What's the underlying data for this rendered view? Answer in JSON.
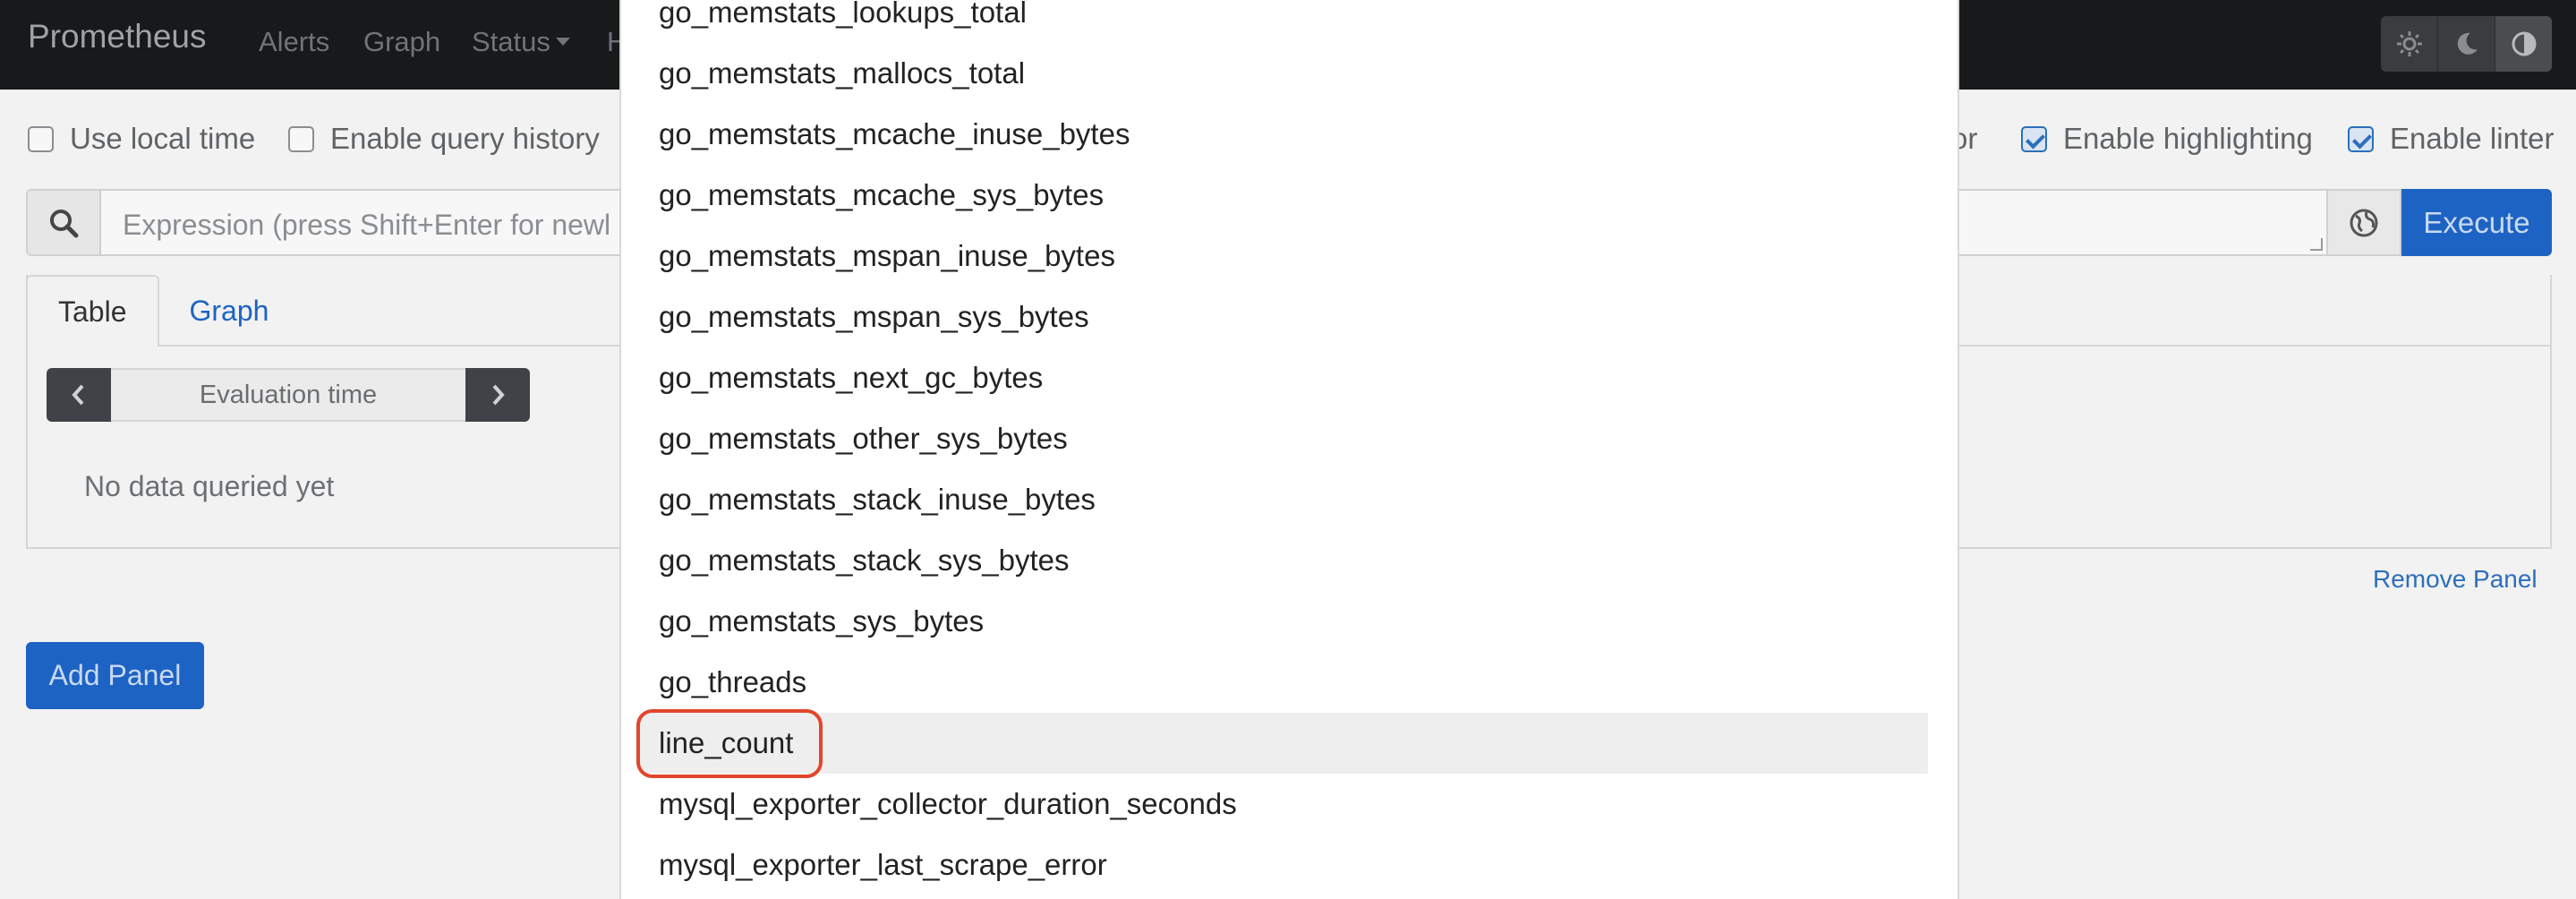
{
  "navbar": {
    "brand": "Prometheus",
    "links": [
      "Alerts",
      "Graph",
      "Status",
      "H"
    ],
    "theme_icons": [
      "sun-icon",
      "moon-icon",
      "half-circle-icon"
    ]
  },
  "options": {
    "use_local_time": "Use local time",
    "enable_query_history": "Enable query history",
    "partial_autocomplete_suffix": "or",
    "enable_highlighting": "Enable highlighting",
    "enable_linter": "Enable linter"
  },
  "expression": {
    "placeholder": "Expression (press Shift+Enter for newl",
    "execute_label": "Execute"
  },
  "panel": {
    "tabs": [
      "Table",
      "Graph"
    ],
    "evaluation_time_placeholder": "Evaluation time",
    "empty_message": "No data queried yet",
    "remove_label": "Remove Panel"
  },
  "add_panel_label": "Add Panel",
  "autocomplete": {
    "items": [
      "go_memstats_lookups_total",
      "go_memstats_mallocs_total",
      "go_memstats_mcache_inuse_bytes",
      "go_memstats_mcache_sys_bytes",
      "go_memstats_mspan_inuse_bytes",
      "go_memstats_mspan_sys_bytes",
      "go_memstats_next_gc_bytes",
      "go_memstats_other_sys_bytes",
      "go_memstats_stack_inuse_bytes",
      "go_memstats_stack_sys_bytes",
      "go_memstats_sys_bytes",
      "go_threads",
      "line_count",
      "mysql_exporter_collector_duration_seconds",
      "mysql_exporter_last_scrape_error"
    ],
    "selected_index": 12
  },
  "colors": {
    "primary": "#1d63c4",
    "navbar": "#17191b",
    "highlight_ring": "#e2462c"
  }
}
